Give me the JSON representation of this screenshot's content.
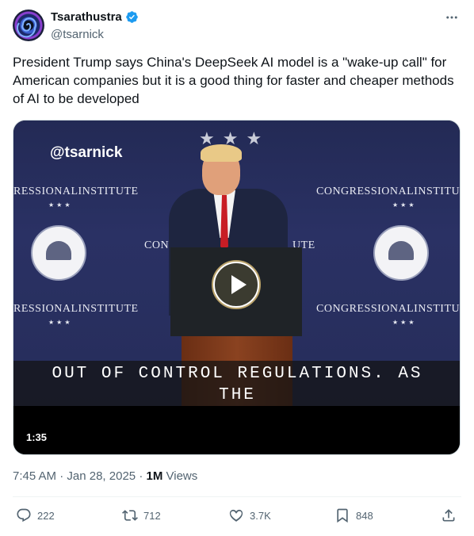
{
  "author": {
    "display_name": "Tsarathustra",
    "handle": "@tsarnick",
    "verified": true,
    "avatar_icon": "swirl-avatar"
  },
  "tweet": {
    "text": "President Trump says China's DeepSeek AI model is a \"wake-up call\" for American companies but it is a good thing for faster and cheaper methods of AI to be developed"
  },
  "video": {
    "watermark": "@tsarnick",
    "backdrop_text": {
      "left_top": "RESSIONALINSTITUTE",
      "right_top": "CONGRESSIONALINSTITU",
      "center_left": "CON",
      "center_right": "UTE",
      "left_bottom": "RESSIONALINSTITUTE",
      "right_bottom": "CONGRESSIONALINSTITU",
      "stars": "★★★"
    },
    "caption_line1": "OUT OF CONTROL REGULATIONS. AS",
    "caption_line2": "THE",
    "duration": "1:35"
  },
  "meta": {
    "time": "7:45 AM",
    "date": "Jan 28, 2025",
    "separator": "·",
    "views_count": "1M",
    "views_label": "Views"
  },
  "actions": {
    "replies": "222",
    "reposts": "712",
    "likes": "3.7K",
    "bookmarks": "848"
  },
  "colors": {
    "text_primary": "#0f1419",
    "text_secondary": "#536471",
    "verified_blue": "#1d9bf0",
    "divider": "#eff3f4"
  }
}
